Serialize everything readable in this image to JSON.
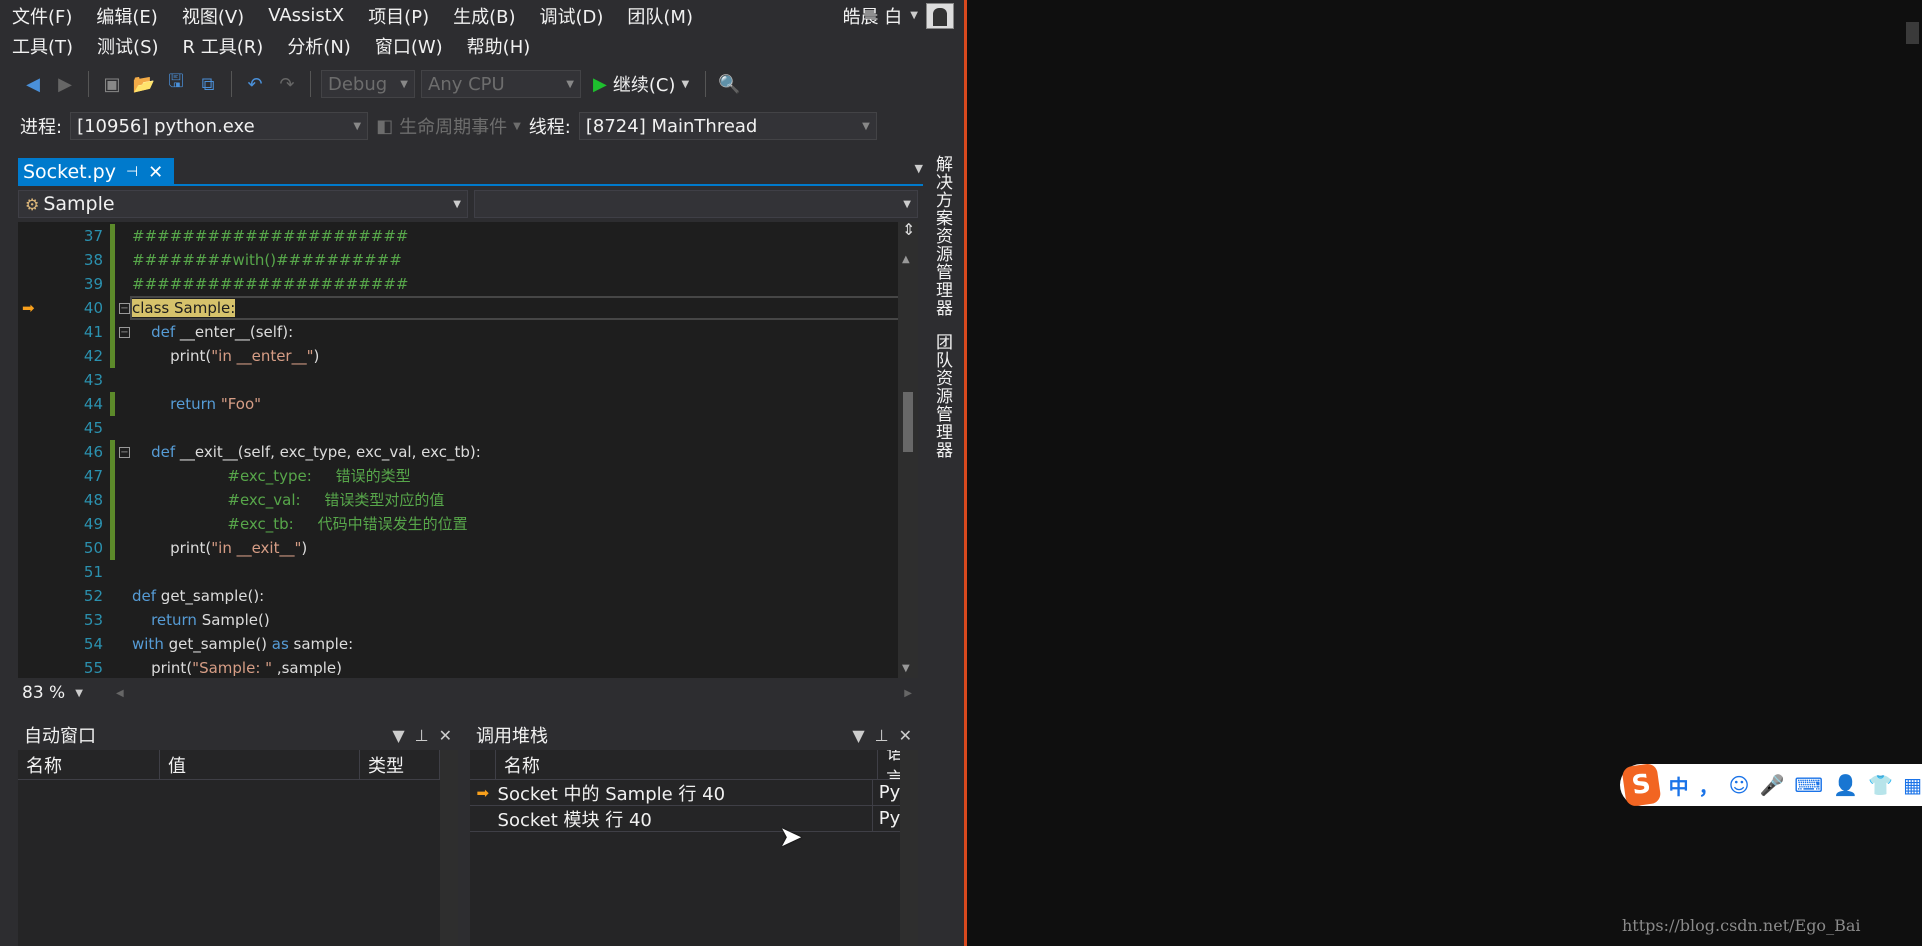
{
  "menu": {
    "row1": [
      "文件(F)",
      "编辑(E)",
      "视图(V)",
      "VAssistX",
      "项目(P)",
      "生成(B)",
      "调试(D)",
      "团队(M)"
    ],
    "row2": [
      "工具(T)",
      "测试(S)",
      "R 工具(R)",
      "分析(N)",
      "窗口(W)",
      "帮助(H)"
    ],
    "user": "皓晨 白"
  },
  "toolbar": {
    "config": "Debug",
    "platform": "Any CPU",
    "continue_label": "继续(C)"
  },
  "debug_bar": {
    "process_label": "进程:",
    "process_value": "[10956] python.exe",
    "lifecycle_label": "生命周期事件",
    "thread_label": "线程:",
    "thread_value": "[8724] MainThread"
  },
  "document": {
    "tab_label": "Socket.py",
    "nav_left": "Sample",
    "nav_right": ""
  },
  "editor": {
    "lines": [
      {
        "n": "37",
        "parts": [
          [
            "c-com",
            "######################"
          ]
        ]
      },
      {
        "n": "38",
        "parts": [
          [
            "c-com",
            "########with()##########"
          ]
        ]
      },
      {
        "n": "39",
        "parts": [
          [
            "c-com",
            "######################"
          ]
        ]
      },
      {
        "n": "40",
        "parts": [
          [
            "hl",
            "class Sample:"
          ]
        ]
      },
      {
        "n": "41",
        "parts": [
          [
            "",
            "    "
          ],
          [
            "c-kw",
            "def"
          ],
          [
            "",
            " __enter__(self):"
          ]
        ]
      },
      {
        "n": "42",
        "parts": [
          [
            "",
            "        print("
          ],
          [
            "c-str",
            "\"in __enter__\""
          ],
          [
            "",
            ")"
          ]
        ]
      },
      {
        "n": "43",
        "parts": [
          [
            "",
            ""
          ]
        ]
      },
      {
        "n": "44",
        "parts": [
          [
            "",
            "        "
          ],
          [
            "c-kw",
            "return"
          ],
          [
            "",
            " "
          ],
          [
            "c-str",
            "\"Foo\""
          ]
        ]
      },
      {
        "n": "45",
        "parts": [
          [
            "",
            ""
          ]
        ]
      },
      {
        "n": "46",
        "parts": [
          [
            "",
            "    "
          ],
          [
            "c-kw",
            "def"
          ],
          [
            "",
            " __exit__(self, exc_type, exc_val, exc_tb):"
          ]
        ]
      },
      {
        "n": "47",
        "parts": [
          [
            "",
            "                    "
          ],
          [
            "c-com",
            "#exc_type:     错误的类型"
          ]
        ]
      },
      {
        "n": "48",
        "parts": [
          [
            "",
            "                    "
          ],
          [
            "c-com",
            "#exc_val:     错误类型对应的值"
          ]
        ]
      },
      {
        "n": "49",
        "parts": [
          [
            "",
            "                    "
          ],
          [
            "c-com",
            "#exc_tb:     代码中错误发生的位置"
          ]
        ]
      },
      {
        "n": "50",
        "parts": [
          [
            "",
            "        print("
          ],
          [
            "c-str",
            "\"in __exit__\""
          ],
          [
            "",
            ")"
          ]
        ]
      },
      {
        "n": "51",
        "parts": [
          [
            "",
            ""
          ]
        ]
      },
      {
        "n": "52",
        "parts": [
          [
            "c-kw",
            "def"
          ],
          [
            "",
            " get_sample():"
          ]
        ]
      },
      {
        "n": "53",
        "parts": [
          [
            "",
            "    "
          ],
          [
            "c-kw",
            "return"
          ],
          [
            "",
            " Sample()"
          ]
        ]
      },
      {
        "n": "54",
        "parts": [
          [
            "c-kw",
            "with"
          ],
          [
            "",
            " get_sample() "
          ],
          [
            "c-kw",
            "as"
          ],
          [
            "",
            " sample:"
          ]
        ]
      },
      {
        "n": "55",
        "parts": [
          [
            "",
            "    print("
          ],
          [
            "c-str",
            "\"Sample: \""
          ],
          [
            "",
            " ,sample)"
          ]
        ]
      }
    ],
    "zoom": "83 %"
  },
  "side_tabs": [
    "解决方案资源管理器",
    "团队资源管理器"
  ],
  "autos": {
    "title": "自动窗口",
    "columns": [
      "名称",
      "值",
      "类型"
    ]
  },
  "callstack": {
    "title": "调用堆栈",
    "columns": [
      "名称",
      "语言"
    ],
    "rows": [
      {
        "name": "Socket 中的 Sample  行 40",
        "lang": "Python",
        "current": true
      },
      {
        "name": "Socket 模块 行 40",
        "lang": "Python",
        "current": false
      }
    ]
  },
  "ime": {
    "items": [
      "中",
      "，",
      "☺",
      "🎤",
      "⌨",
      "👤",
      "👕",
      "▦"
    ]
  },
  "watermark": "https://blog.csdn.net/Ego_Bai"
}
